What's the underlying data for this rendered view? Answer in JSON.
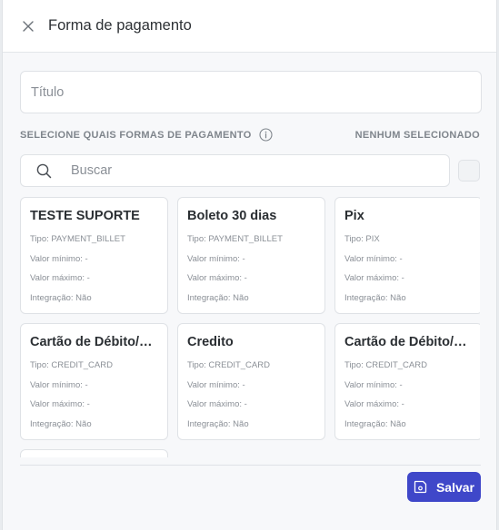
{
  "header": {
    "title": "Forma de pagamento"
  },
  "form": {
    "title_placeholder": "Título"
  },
  "section": {
    "label": "SELECIONE QUAIS FORMAS DE PAGAMENTO",
    "selection_status": "NENHUM SELECIONADO"
  },
  "search": {
    "placeholder": "Buscar"
  },
  "cards": [
    {
      "title": "TESTE SUPORTE",
      "type": "Tipo: PAYMENT_BILLET",
      "min": "Valor mínimo: -",
      "max": "Valor máximo: -",
      "integration": "Integração: Não"
    },
    {
      "title": "Boleto 30 dias",
      "type": "Tipo: PAYMENT_BILLET",
      "min": "Valor mínimo: -",
      "max": "Valor máximo: -",
      "integration": "Integração: Não"
    },
    {
      "title": "Pix",
      "type": "Tipo: PIX",
      "min": "Valor mínimo: -",
      "max": "Valor máximo: -",
      "integration": "Integração: Não"
    },
    {
      "title": "Cartão de Débito/C...",
      "type": "Tipo: CREDIT_CARD",
      "min": "Valor mínimo: -",
      "max": "Valor máximo: -",
      "integration": "Integração: Não"
    },
    {
      "title": "Credito",
      "type": "Tipo: CREDIT_CARD",
      "min": "Valor mínimo: -",
      "max": "Valor máximo: -",
      "integration": "Integração: Não"
    },
    {
      "title": "Cartão de Débito/C...",
      "type": "Tipo: CREDIT_CARD",
      "min": "Valor mínimo: -",
      "max": "Valor máximo: -",
      "integration": "Integração: Não"
    }
  ],
  "footer": {
    "save_label": "Salvar"
  },
  "colors": {
    "primary": "#3f47c9",
    "background": "#f7f8fa",
    "border": "#dfe2e6",
    "muted_text": "#8a8f96"
  },
  "icons": {
    "close": "close-icon",
    "info": "info-icon",
    "search": "search-icon",
    "save": "save-icon"
  }
}
